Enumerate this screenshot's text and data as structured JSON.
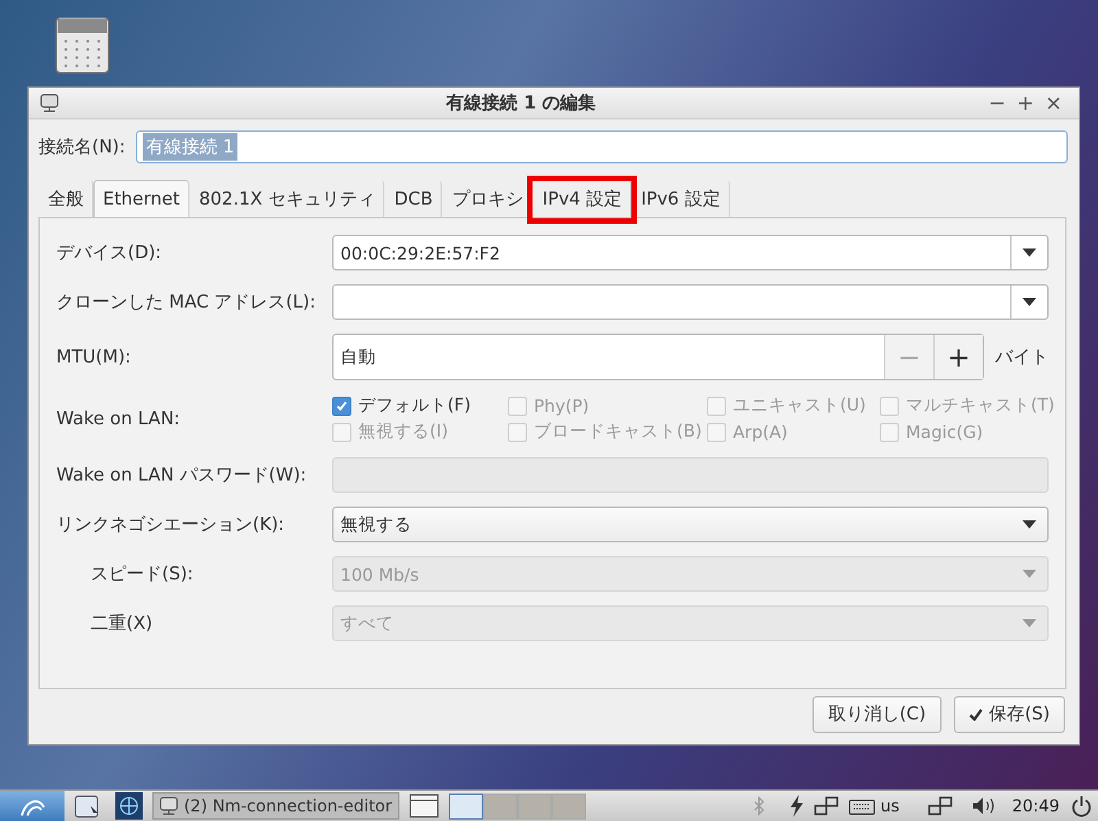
{
  "window": {
    "title": "有線接続 1 の編集",
    "controls": [
      "−",
      "+",
      "×"
    ]
  },
  "connection_name": {
    "label": "接続名(N):",
    "value": "有線接続 1",
    "selected_text": true
  },
  "tabs": [
    {
      "label": "全般",
      "selected": false,
      "highlighted": false
    },
    {
      "label": "Ethernet",
      "selected": true,
      "highlighted": false
    },
    {
      "label": "802.1X セキュリティ",
      "selected": false,
      "highlighted": false
    },
    {
      "label": "DCB",
      "selected": false,
      "highlighted": false
    },
    {
      "label": "プロキシ",
      "selected": false,
      "highlighted": false
    },
    {
      "label": "IPv4 設定",
      "selected": false,
      "highlighted": true
    },
    {
      "label": "IPv6 設定",
      "selected": false,
      "highlighted": false
    }
  ],
  "rows": [
    {
      "kind": "combo",
      "label": "デバイス(D):",
      "value": "00:0C:29:2E:57:F2",
      "indented": false,
      "disabled": false,
      "editable": true
    },
    {
      "kind": "combo",
      "label": "クローンした MAC アドレス(L):",
      "value": "",
      "indented": false,
      "disabled": false,
      "editable": true
    },
    {
      "kind": "spin",
      "label": "MTU(M):",
      "value": "自動",
      "minus": "−",
      "plus": "+",
      "unit": "バイト",
      "indented": false
    },
    {
      "kind": "checks",
      "label": "Wake on LAN:",
      "indented": false,
      "options": [
        {
          "label": "デフォルト(F)",
          "checked": true,
          "disabled": false
        },
        {
          "label": "Phy(P)",
          "checked": false,
          "disabled": true
        },
        {
          "label": "ユニキャスト(U)",
          "checked": false,
          "disabled": true
        },
        {
          "label": "マルチキャスト(T)",
          "checked": false,
          "disabled": true
        },
        {
          "label": "無視する(I)",
          "checked": false,
          "disabled": true
        },
        {
          "label": "ブロードキャスト(B)",
          "checked": false,
          "disabled": true
        },
        {
          "label": "Arp(A)",
          "checked": false,
          "disabled": true
        },
        {
          "label": "Magic(G)",
          "checked": false,
          "disabled": true
        }
      ]
    },
    {
      "kind": "text",
      "label": "Wake on LAN パスワード(W):",
      "value": "",
      "indented": false,
      "disabled": true
    },
    {
      "kind": "combo",
      "label": "リンクネゴシエーション(K):",
      "value": "無視する",
      "indented": false,
      "disabled": false,
      "editable": false
    },
    {
      "kind": "combo",
      "label": "スピード(S):",
      "value": "100 Mb/s",
      "indented": true,
      "disabled": true,
      "editable": false
    },
    {
      "kind": "combo",
      "label": "二重(X)",
      "value": "すべて",
      "indented": true,
      "disabled": true,
      "editable": false
    }
  ],
  "buttons": [
    {
      "label": "取り消し(C)",
      "icon": false
    },
    {
      "label": "保存(S)",
      "icon": true
    }
  ],
  "taskbar": {
    "task": "(2) Nm-connection-editor",
    "workspaces": [
      {
        "selected": true
      },
      {
        "selected": false
      },
      {
        "selected": false
      },
      {
        "selected": false
      }
    ],
    "layout": "us",
    "clock": "20:49"
  }
}
